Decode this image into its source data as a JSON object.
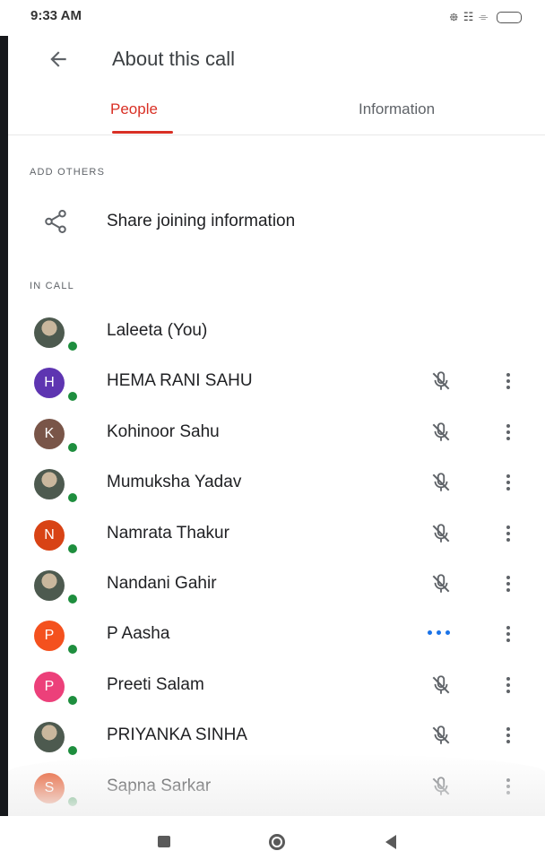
{
  "status_bar": {
    "time": "9:33 AM",
    "icons": "᪥ ☷ ⌯"
  },
  "header": {
    "title": "About this call"
  },
  "tabs": [
    {
      "label": "People",
      "selected": true
    },
    {
      "label": "Information",
      "selected": false
    }
  ],
  "add_others": {
    "section_label": "ADD OTHERS",
    "share_label": "Share joining information"
  },
  "in_call": {
    "section_label": "IN CALL",
    "participants": [
      {
        "name": "Laleeta (You)",
        "initial": "",
        "avatar_color": "#4d5a4f",
        "avatar_photo": true,
        "status": "none"
      },
      {
        "name": "HEMA RANI SAHU",
        "initial": "H",
        "avatar_color": "#5e35b1",
        "status": "muted"
      },
      {
        "name": "Kohinoor Sahu",
        "initial": "K",
        "avatar_color": "#795548",
        "status": "muted"
      },
      {
        "name": "Mumuksha Yadav",
        "initial": "",
        "avatar_color": "#546e7a",
        "avatar_photo": true,
        "status": "muted"
      },
      {
        "name": "Namrata Thakur",
        "initial": "N",
        "avatar_color": "#d84315",
        "status": "muted"
      },
      {
        "name": "Nandani Gahir",
        "initial": "",
        "avatar_color": "#3e2723",
        "avatar_photo": true,
        "status": "muted"
      },
      {
        "name": "P Aasha",
        "initial": "P",
        "avatar_color": "#f4511e",
        "status": "speaking"
      },
      {
        "name": "Preeti Salam",
        "initial": "P",
        "avatar_color": "#ec407a",
        "status": "muted"
      },
      {
        "name": "PRIYANKA SINHA",
        "initial": "",
        "avatar_color": "#8d6e63",
        "avatar_photo": true,
        "status": "muted"
      },
      {
        "name": "Sapna Sarkar",
        "initial": "S",
        "avatar_color": "#e64a19",
        "status": "muted"
      }
    ]
  },
  "colors": {
    "accent": "#d93025",
    "online": "#1e8e3e",
    "speaking": "#1a73e8"
  }
}
